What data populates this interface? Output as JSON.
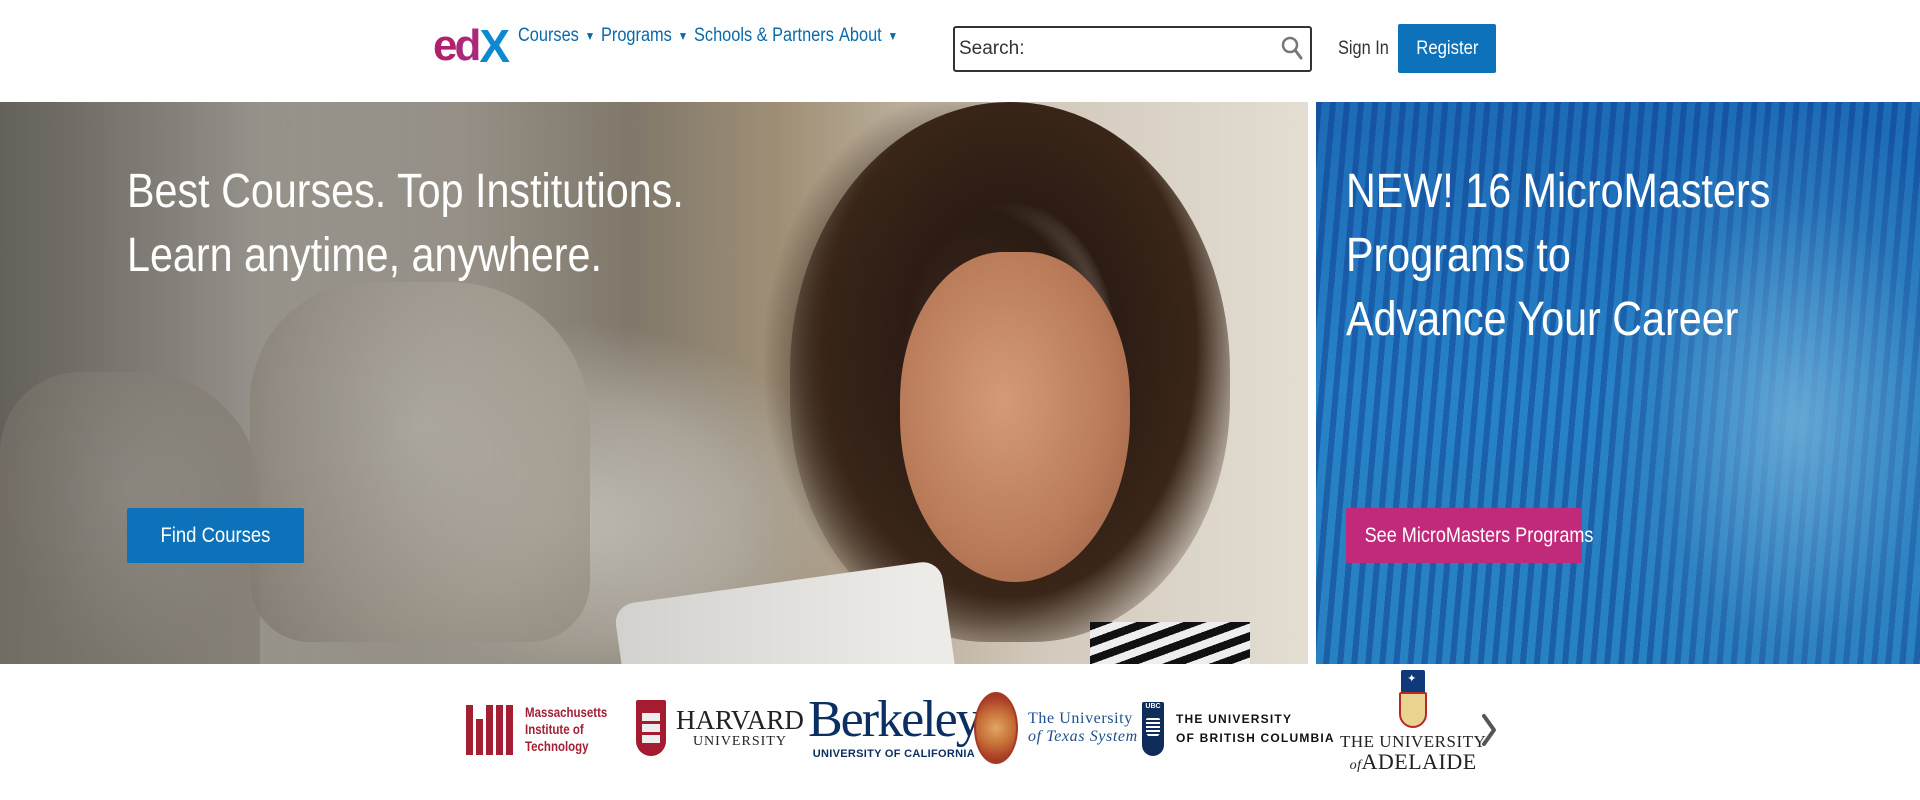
{
  "header": {
    "logo": {
      "e": "e",
      "d": "d",
      "x": "X"
    },
    "nav": [
      {
        "label": "Courses",
        "has_dropdown": true
      },
      {
        "label": "Programs",
        "has_dropdown": true
      },
      {
        "label": "Schools & Partners",
        "has_dropdown": false
      },
      {
        "label": "About",
        "has_dropdown": true
      }
    ],
    "dropdown_icon": "caret-down-icon",
    "search": {
      "placeholder": "Search:",
      "value": "",
      "icon": "search-icon"
    },
    "sign_in": "Sign In",
    "register": "Register"
  },
  "hero": {
    "left": {
      "line1": "Best Courses. Top Institutions.",
      "line2": "Learn anytime, anywhere.",
      "button": "Find Courses"
    },
    "right": {
      "line1": "NEW! 16 MicroMasters Programs to",
      "line2": "Advance Your Career",
      "button": "See MicroMasters Programs"
    }
  },
  "partners": {
    "mit": {
      "line1": "Massachusetts",
      "line2": "Institute of",
      "line3": "Technology"
    },
    "harvard": {
      "name": "HARVARD",
      "sub": "UNIVERSITY"
    },
    "berkeley": {
      "name": "Berkeley",
      "sub": "UNIVERSITY OF CALIFORNIA"
    },
    "texas": {
      "line1": "The University",
      "line2": "of Texas System"
    },
    "ubc": {
      "badge": "UBC",
      "line1": "THE UNIVERSITY",
      "line2": "OF BRITISH COLUMBIA"
    },
    "adelaide": {
      "line1": "THE UNIVERSITY",
      "line2_prefix": "of",
      "line2": "ADELAIDE"
    },
    "next_icon": "chevron-right-icon"
  },
  "colors": {
    "brand_blue": "#0d72b9",
    "link_blue": "#0a69a8",
    "micromasters_pink": "#c12a7b"
  }
}
